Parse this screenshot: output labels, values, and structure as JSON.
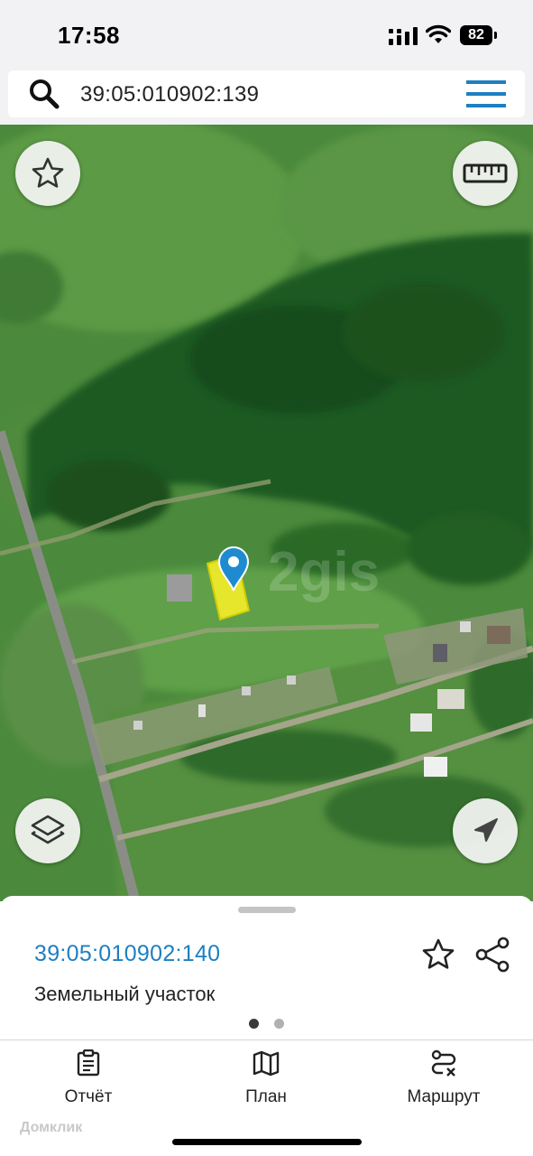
{
  "status_bar": {
    "time": "17:58",
    "battery": "82"
  },
  "search": {
    "query": "39:05:010902:139"
  },
  "map": {
    "watermark": "2gis",
    "buttons": {
      "favorite_icon": "star-icon",
      "ruler_icon": "ruler-icon",
      "layers_icon": "layers-icon",
      "locate_icon": "location-arrow-icon"
    },
    "pin_color": "#1e8bd0",
    "parcel_color": "#f2ec2a"
  },
  "sheet": {
    "parcel_id": "39:05:010902:140",
    "parcel_type": "Земельный участок",
    "pages": 2,
    "active_page": 1
  },
  "tabs": [
    {
      "label": "Отчёт",
      "icon": "clipboard-icon"
    },
    {
      "label": "План",
      "icon": "map-icon"
    },
    {
      "label": "Маршрут",
      "icon": "route-icon"
    }
  ],
  "footer": {
    "watermark": "Домклик"
  },
  "colors": {
    "accent": "#1e7fc1",
    "link": "#1e7fc1"
  }
}
